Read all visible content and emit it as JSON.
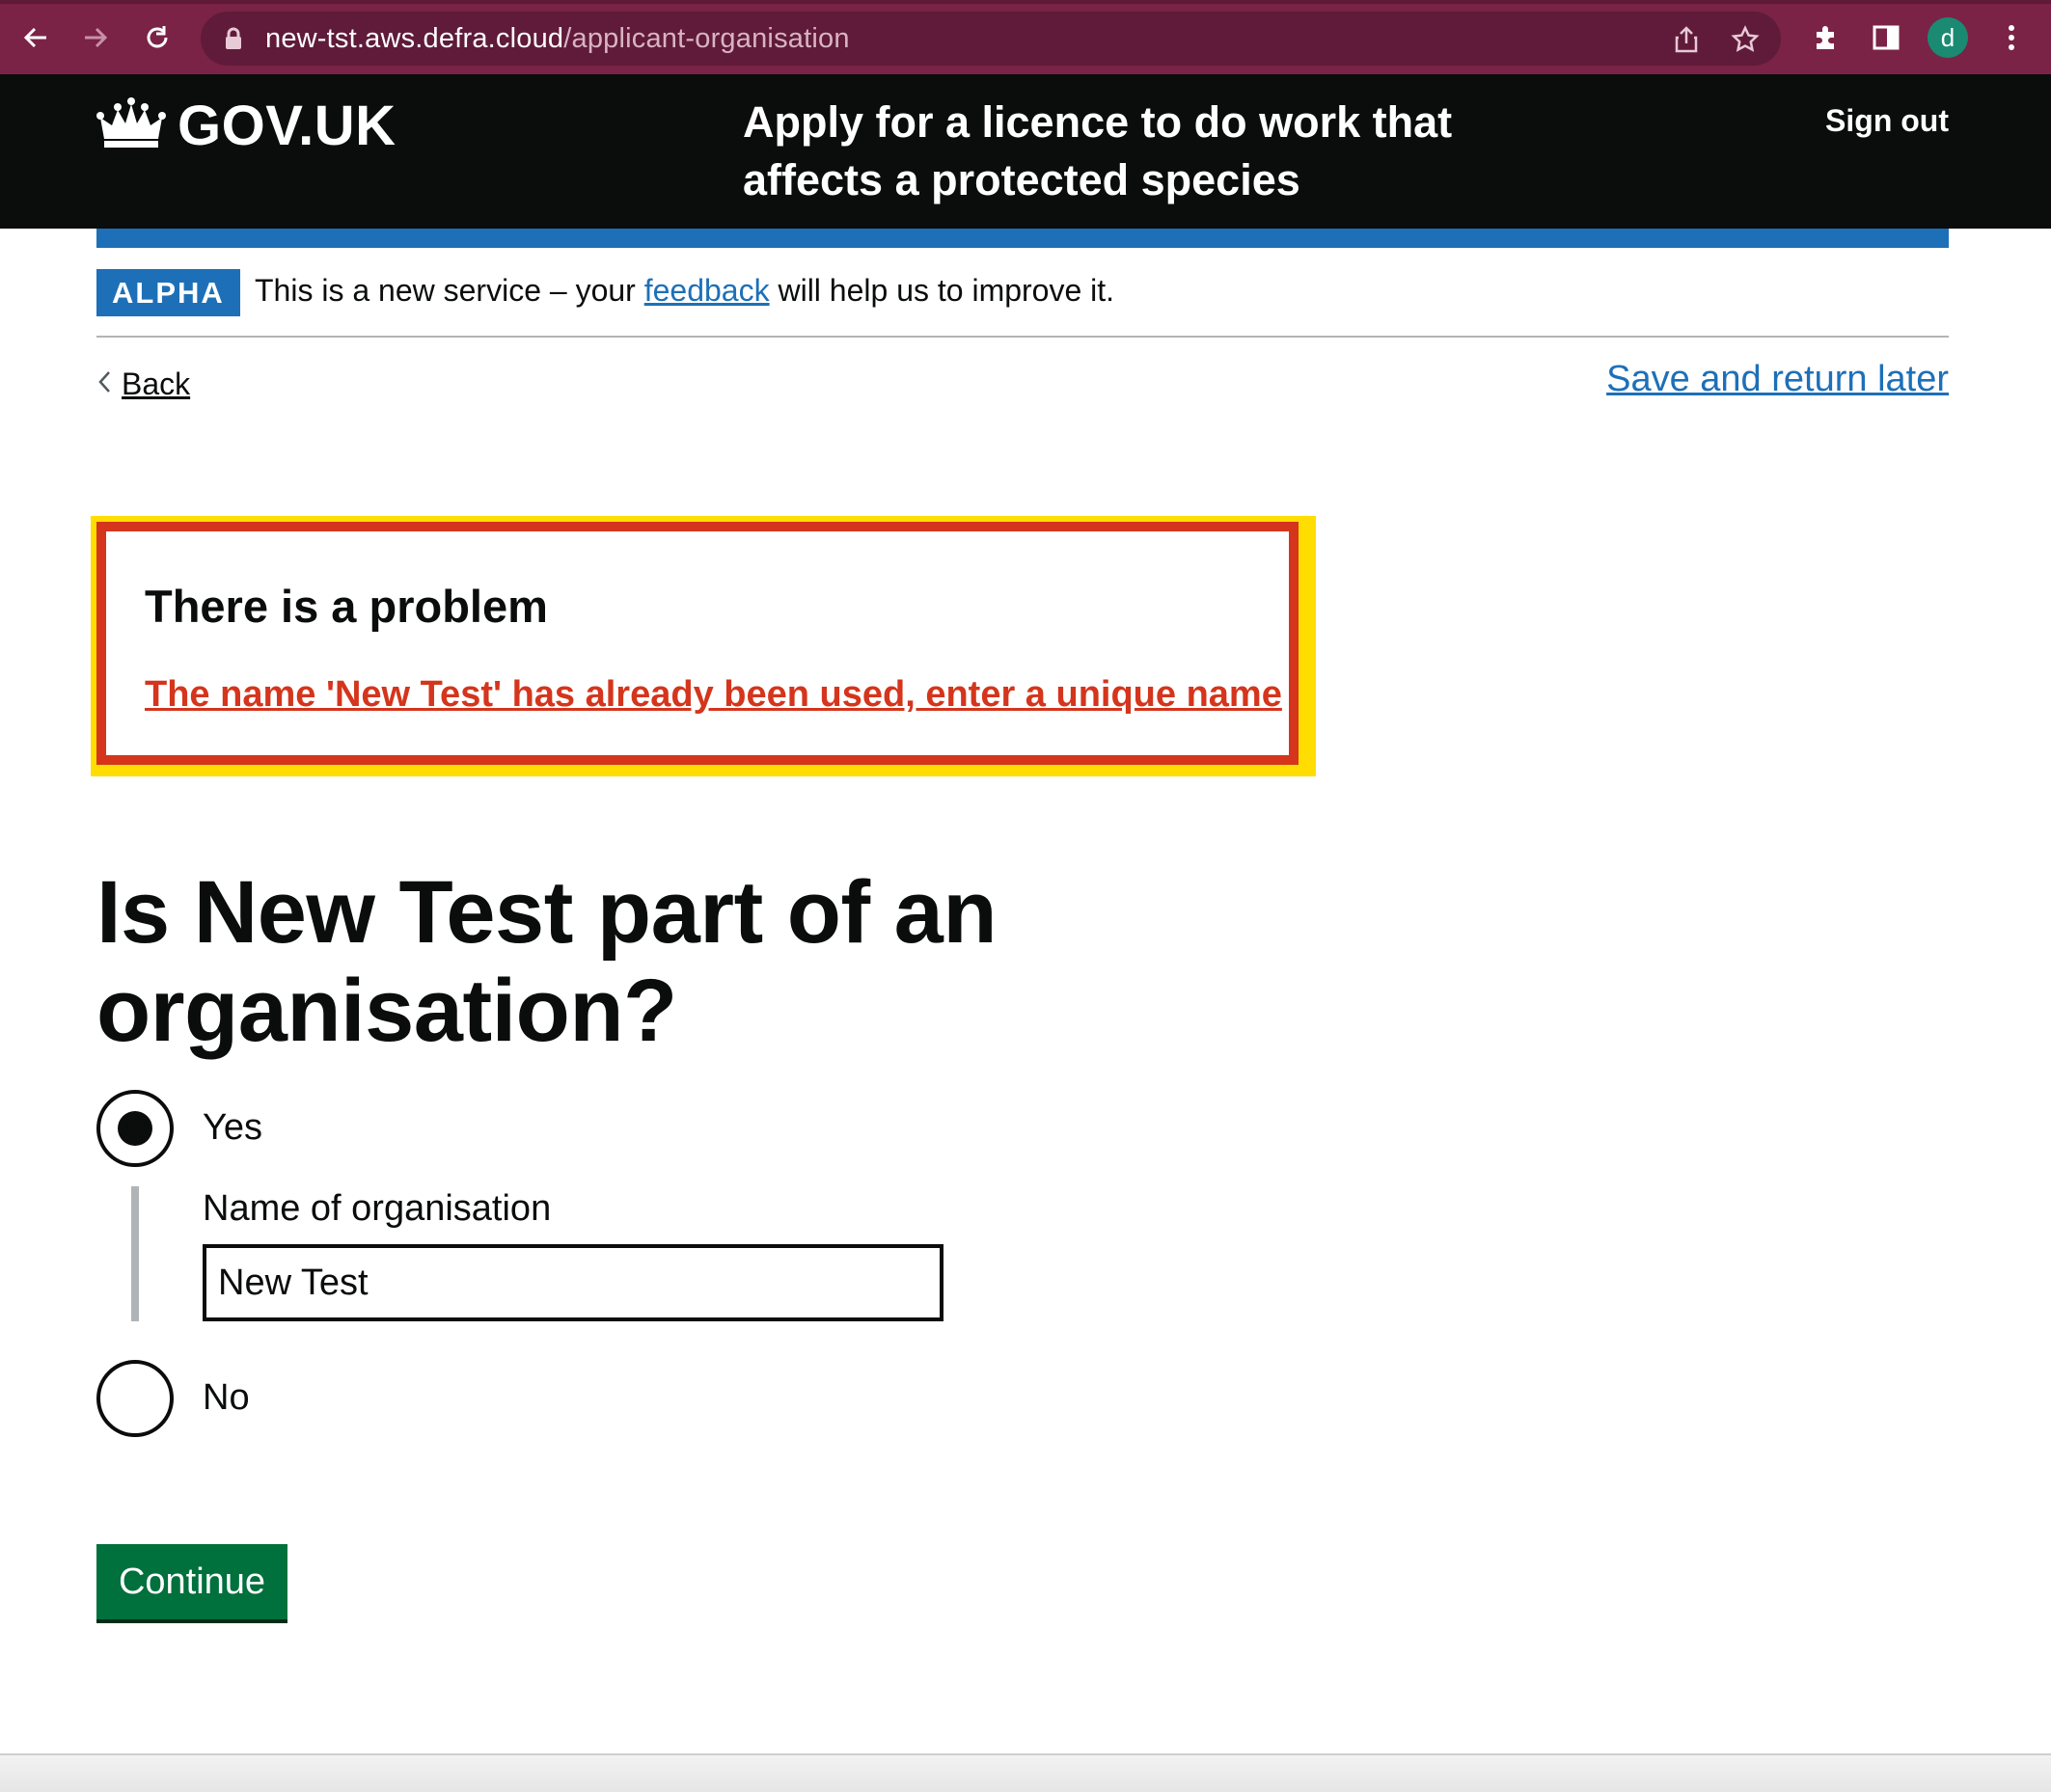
{
  "browser": {
    "url_host": "new-tst.aws.defra.cloud",
    "url_path": "/applicant-organisation",
    "profile_initial": "d",
    "icons": [
      "back-arrow-icon",
      "forward-arrow-icon",
      "reload-icon",
      "lock-icon",
      "share-icon",
      "bookmark-star-icon",
      "extensions-icon",
      "side-panel-icon",
      "kebab-menu-icon"
    ]
  },
  "header": {
    "logo_text": "GOV.UK",
    "service_name": "Apply for a licence to do work that affects a protected species",
    "sign_out": "Sign out"
  },
  "phase_banner": {
    "tag": "ALPHA",
    "text_before": "This is a new service – your ",
    "link": "feedback",
    "text_after": " will help us to improve it."
  },
  "nav": {
    "back": "Back",
    "save_later": "Save and return later"
  },
  "error_summary": {
    "title": "There is a problem",
    "message": "The name 'New Test' has already been used, enter a unique name"
  },
  "form": {
    "question": "Is New Test part of an organisation?",
    "options": [
      {
        "label": "Yes",
        "selected": true
      },
      {
        "label": "No",
        "selected": false
      }
    ],
    "org_name_label": "Name of organisation",
    "org_name_value": "New Test",
    "continue": "Continue"
  },
  "colors": {
    "browser_frame": "#7a2346",
    "header_black": "#0b0c0c",
    "brand_blue": "#1d70b8",
    "error_red": "#d4351c",
    "focus_yellow": "#ffdd00",
    "button_green": "#00703c"
  }
}
